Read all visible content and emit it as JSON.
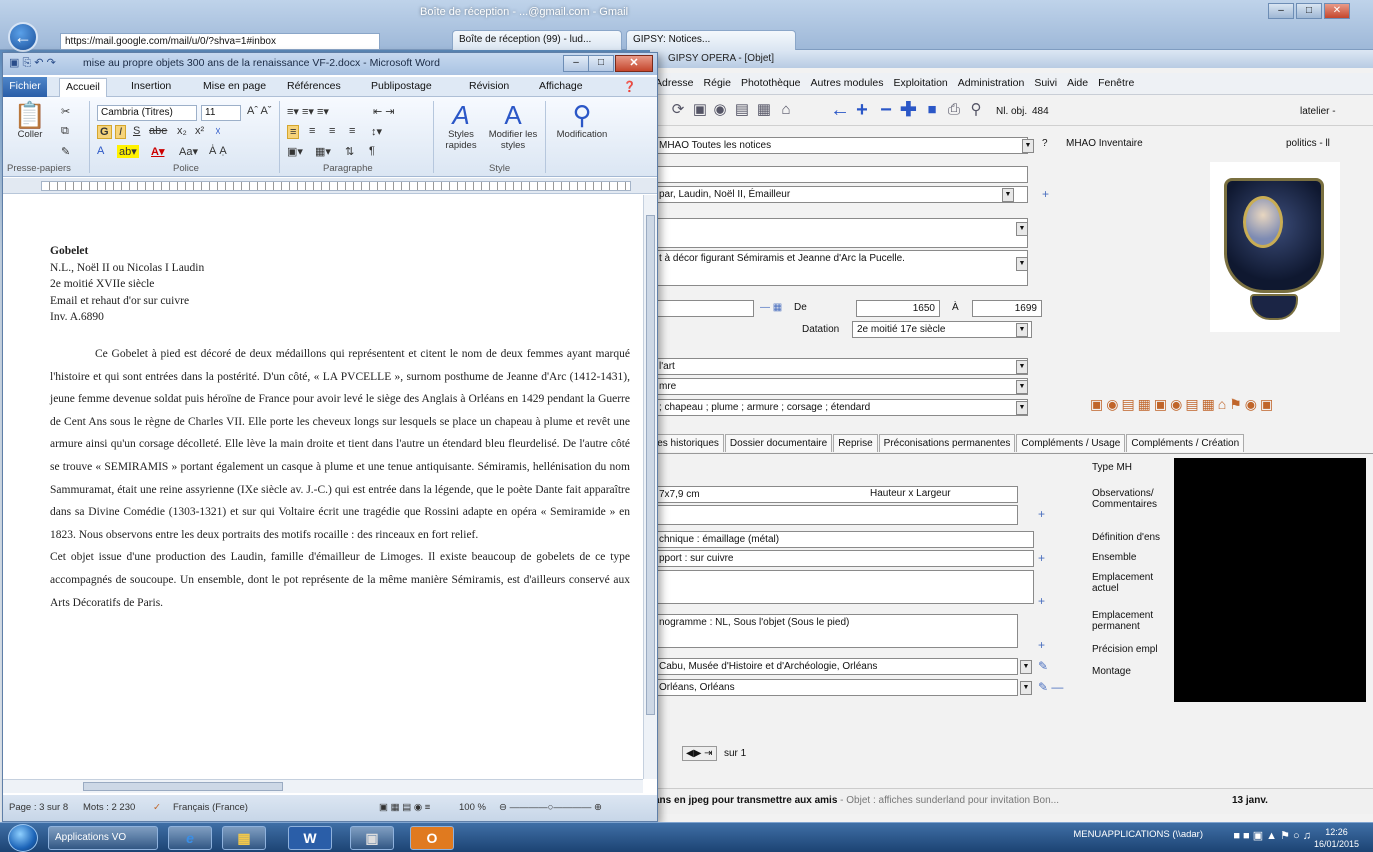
{
  "browser": {
    "title": "Boîte de réception - ...@gmail.com - Gmail",
    "address": "https://mail.google.com/mail/u/0/?shva=1#inbox",
    "tabs": [
      {
        "label": "Boîte de réception (99) - lud..."
      },
      {
        "label": "GIPSY: Notices..."
      }
    ]
  },
  "word": {
    "title": "mise au propre objets 300 ans de la renaissance VF-2.docx - Microsoft Word",
    "ribbon_tabs": [
      "Fichier",
      "Accueil",
      "Insertion",
      "Mise en page",
      "Références",
      "Publipostage",
      "Révision",
      "Affichage"
    ],
    "font_name": "Cambria (Titres)",
    "font_size": "11",
    "groups": [
      "Presse-papiers",
      "Police",
      "Paragraphe",
      "Style"
    ],
    "paste_label": "Coller",
    "styles_label": "Styles rapides",
    "change_styles_label": "Modifier les styles",
    "edit_label": "Modification",
    "doc_heading": [
      "Gobelet",
      "N.L., Noël II ou Nicolas I Laudin",
      "2e moitié XVIIe siècle",
      "Email et rehaut d'or sur cuivre",
      "Inv. A.6890"
    ],
    "paragraph1": "Ce Gobelet à pied est décoré de deux médaillons qui représentent et citent le nom de deux femmes ayant marqué l'histoire et qui sont entrées dans la postérité. D'un côté, « LA PVCELLE », surnom posthume de Jeanne d'Arc (1412-1431), jeune femme devenue soldat puis héroïne de France pour avoir levé le siège des Anglais à Orléans en 1429 pendant la Guerre de Cent Ans sous le règne de Charles VII. Elle porte les cheveux longs sur lesquels se place un chapeau à plume et revêt une armure ainsi qu'un corsage décolleté. Elle lève la main droite et tient dans l'autre un étendard bleu fleurdelisé. De l'autre côté se trouve « SEMIRAMIS » portant également un casque à plume et une tenue antiquisante. Sémiramis, hellénisation du nom Sammuramat, était une reine assyrienne (IXe siècle av. J.-C.) qui est entrée dans la légende, que le poète Dante fait apparaître dans sa Divine Comédie (1303-1321) et sur qui Voltaire écrit une tragédie que Rossini adapte en opéra « Semiramide » en 1823. Nous observons entre les deux portraits des motifs rocaille : des rinceaux en fort relief.",
    "paragraph2": "Cet objet issue d'une production des Laudin, famille d'émailleur de Limoges. Il existe beaucoup de gobelets de ce type accompagnés de soucoupe. Un ensemble, dont le pot représente de la même manière Sémiramis, est d'ailleurs conservé aux Arts Décoratifs de Paris.",
    "status_page": "Page : 3 sur 8",
    "status_words": "Mots : 2 230",
    "status_lang": "Français (France)",
    "zoom": "100 %"
  },
  "app": {
    "title": "GIPSY OPERA - [Objet]",
    "menu": [
      "Adresse",
      "Régie",
      "Photothèque",
      "Autres modules",
      "Exploitation",
      "Administration",
      "Suivi",
      "Aide",
      "Fenêtre"
    ],
    "record_label": "Nl. obj.",
    "record_number": "484",
    "atelier_label": "latelier -",
    "politics_label": "politics - ll",
    "inventory_label": "MHAO Inventaire",
    "selection": "MHAO Toutes les notices",
    "author": "par, Laudin, Noël II, Émailleur",
    "description": "t à décor figurant Sémiramis et Jeanne d'Arc la Pucelle.",
    "date_from_label": "De",
    "date_from": "1650",
    "date_to_label": "À",
    "date_to": "1699",
    "dating_label": "Datation",
    "dating": "2e moitié 17e siècle",
    "domain": "l'art",
    "category": "mre",
    "keywords": "; chapeau ; plume ; armure ; corsage ; étendard",
    "tabs": [
      "ies historiques",
      "Dossier documentaire",
      "Reprise",
      "Préconisations permanentes",
      "Compléments / Usage",
      "Compléments / Création"
    ],
    "right_labels": [
      "Type MH",
      "Observations/ Commentaires",
      "Définition d'ens",
      "Ensemble",
      "Emplacement actuel",
      "Emplacement permanent",
      "Précision empl",
      "Montage"
    ],
    "dimensions": "7x7,9 cm",
    "dimension_type": "Hauteur x Largeur",
    "technique": "chnique : émaillage (métal)",
    "support": "pport : sur cuivre",
    "inscription": "nogramme : NL, Sous l'objet (Sous le pied)",
    "place1": "Cabu, Musée d'Histoire et d'Archéologie, Orléans",
    "place2": "Orléans, Orléans",
    "pager": "sur 1",
    "status_line": "ans en jpeg pour transmettre aux amis",
    "status_line_rest": "- Objet : affiches sunderland pour invitation Bon...",
    "status_date": "13 janv."
  },
  "taskbar": {
    "apps_label": "Applications VO",
    "tray_label": "MENUAPPLICATIONS (\\\\adar)",
    "time": "12:26",
    "date": "16/01/2015"
  }
}
